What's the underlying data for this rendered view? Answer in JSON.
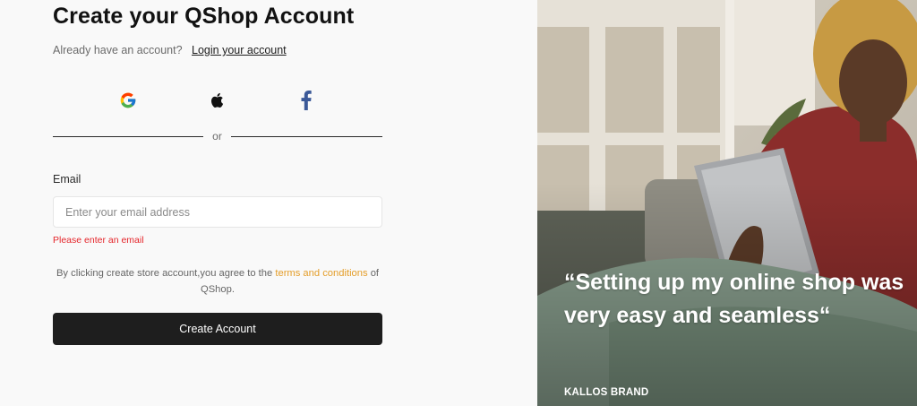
{
  "form": {
    "title": "Create your QShop Account",
    "have_account_text": "Already have an account?",
    "login_link": "Login your account",
    "divider_text": "or",
    "email_label": "Email",
    "email_placeholder": "Enter your email address",
    "email_value": "",
    "error_message": "Please enter an email",
    "terms_prefix": "By clicking create store account,you agree to the ",
    "terms_link": "terms and conditions",
    "terms_suffix": " of QShop.",
    "submit_label": "Create Account"
  },
  "social_icons": [
    "google-icon",
    "apple-icon",
    "facebook-icon"
  ],
  "testimonial": {
    "quote": "“Setting up my online shop was very easy and seamless“",
    "author": "KALLOS BRAND"
  },
  "colors": {
    "button_bg": "#1e1e1e",
    "error": "#e5252a",
    "link_accent": "#e49e2a",
    "facebook": "#3b5998"
  }
}
